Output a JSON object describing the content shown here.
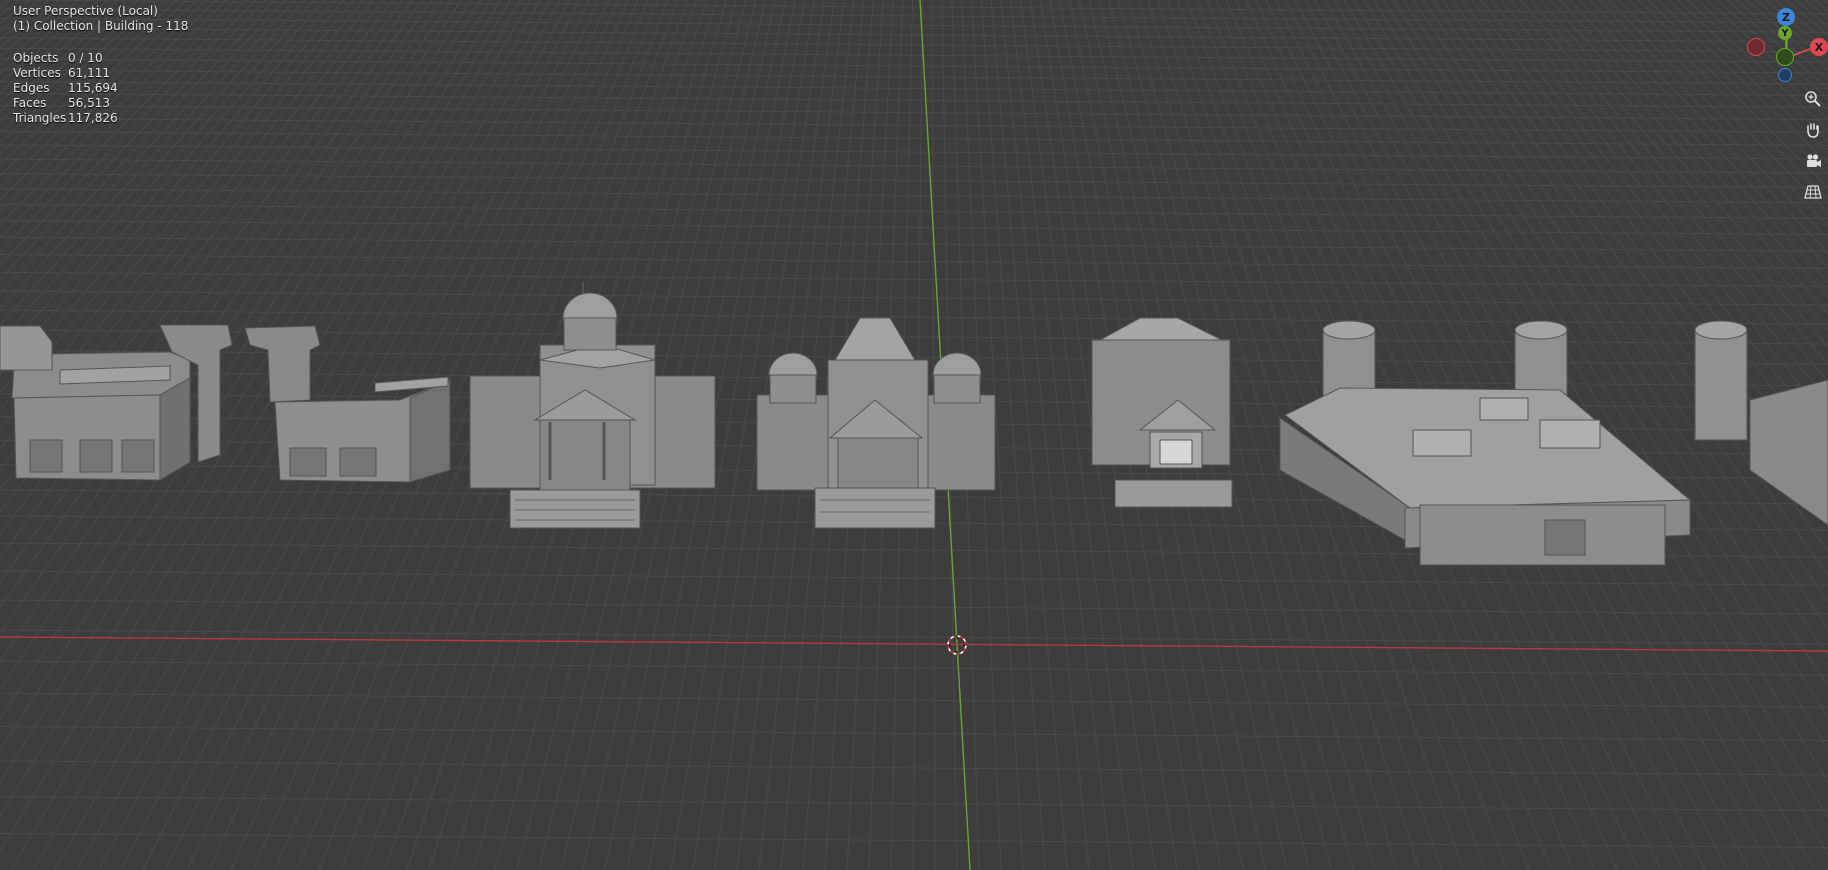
{
  "header": {
    "view_name": "User Perspective (Local)",
    "collection": "(1) Collection | Building - 118"
  },
  "stats": [
    {
      "label": "Objects",
      "value": "0 / 10"
    },
    {
      "label": "Vertices",
      "value": "61,111"
    },
    {
      "label": "Edges",
      "value": "115,694"
    },
    {
      "label": "Faces",
      "value": "56,513"
    },
    {
      "label": "Triangles",
      "value": "117,826"
    }
  ],
  "gizmo": {
    "z_label": "Z",
    "y_label": "Y",
    "x_label": "X",
    "colors": {
      "x": "#e0474f",
      "y": "#6aa52d",
      "z": "#3a86d8"
    }
  },
  "nav_buttons": [
    {
      "icon": "zoom-icon"
    },
    {
      "icon": "hand-pan-icon"
    },
    {
      "icon": "camera-icon"
    },
    {
      "icon": "grid-ortho-icon"
    }
  ],
  "colors": {
    "background": "#3d3d3d",
    "grid_line": "#4a4a4a",
    "x_axis": "#c0393f",
    "y_axis": "#6aa52d",
    "model": "#8f8f8f"
  }
}
